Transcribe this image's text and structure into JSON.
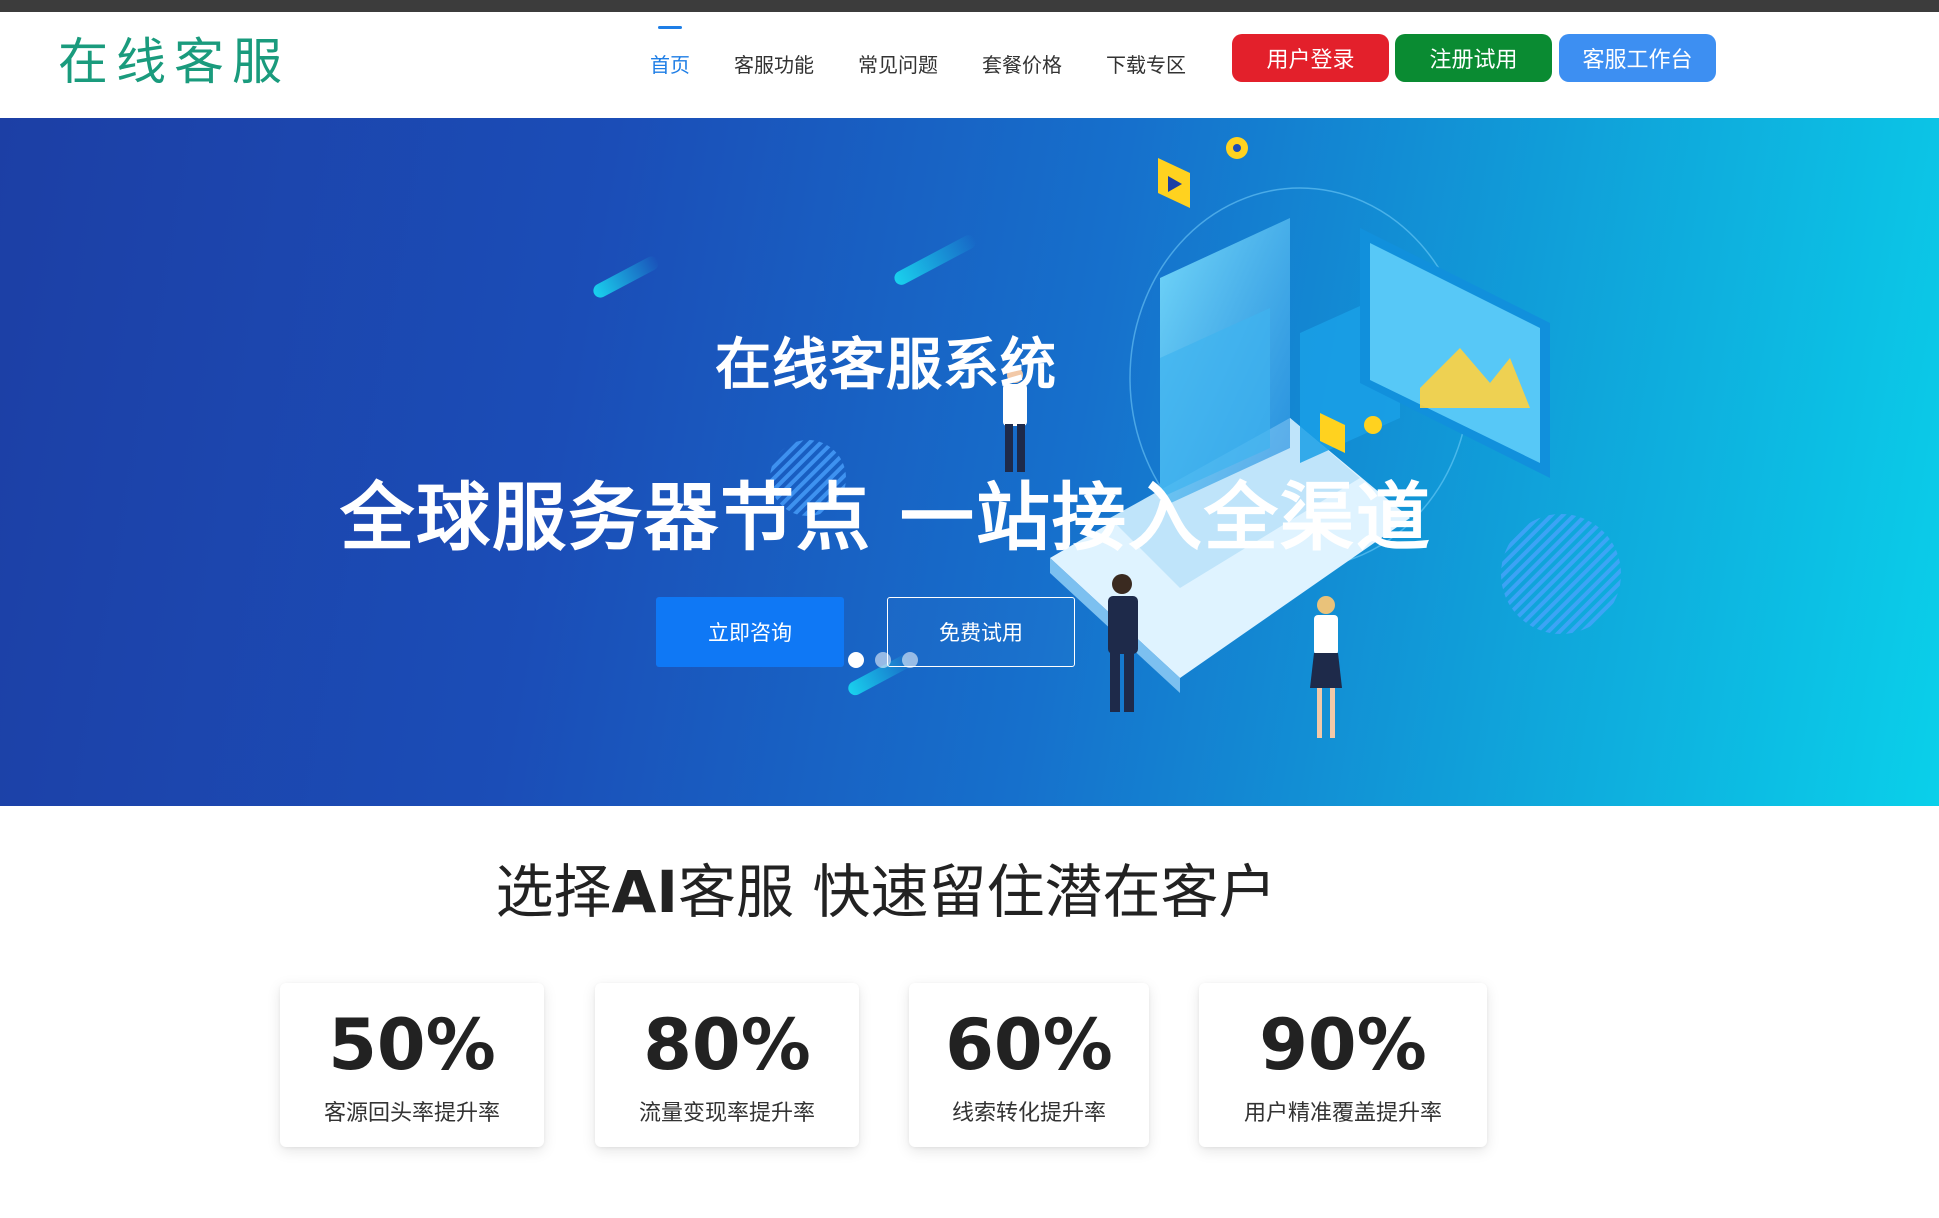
{
  "header": {
    "logo_text": "在线客服",
    "nav": [
      {
        "label": "首页",
        "active": true
      },
      {
        "label": "客服功能"
      },
      {
        "label": "常见问题"
      },
      {
        "label": "套餐价格"
      },
      {
        "label": "下载专区"
      }
    ],
    "buttons": {
      "login": "用户登录",
      "register": "注册试用",
      "workbench": "客服工作台"
    }
  },
  "banner": {
    "title": "在线客服系统",
    "headline": "全球服务器节点 一站接入全渠道",
    "cta_primary": "立即咨询",
    "cta_secondary": "免费试用",
    "carousel_count": 3,
    "carousel_active": 1
  },
  "features": {
    "title_prefix": "选择",
    "title_bold": "AI",
    "title_suffix": "客服 快速留住潜在客户",
    "stats": [
      {
        "value": "50%",
        "label": "客源回头率提升率"
      },
      {
        "value": "80%",
        "label": "流量变现率提升率"
      },
      {
        "value": "60%",
        "label": "线索转化提升率"
      },
      {
        "value": "90%",
        "label": "用户精准覆盖提升率"
      }
    ]
  },
  "colors": {
    "accent": "#1e7ee6",
    "logo": "#1a9b7d",
    "login": "#e3202b",
    "register": "#0a8b32",
    "workbench": "#3d8ff2",
    "cta": "#0f78f5"
  }
}
